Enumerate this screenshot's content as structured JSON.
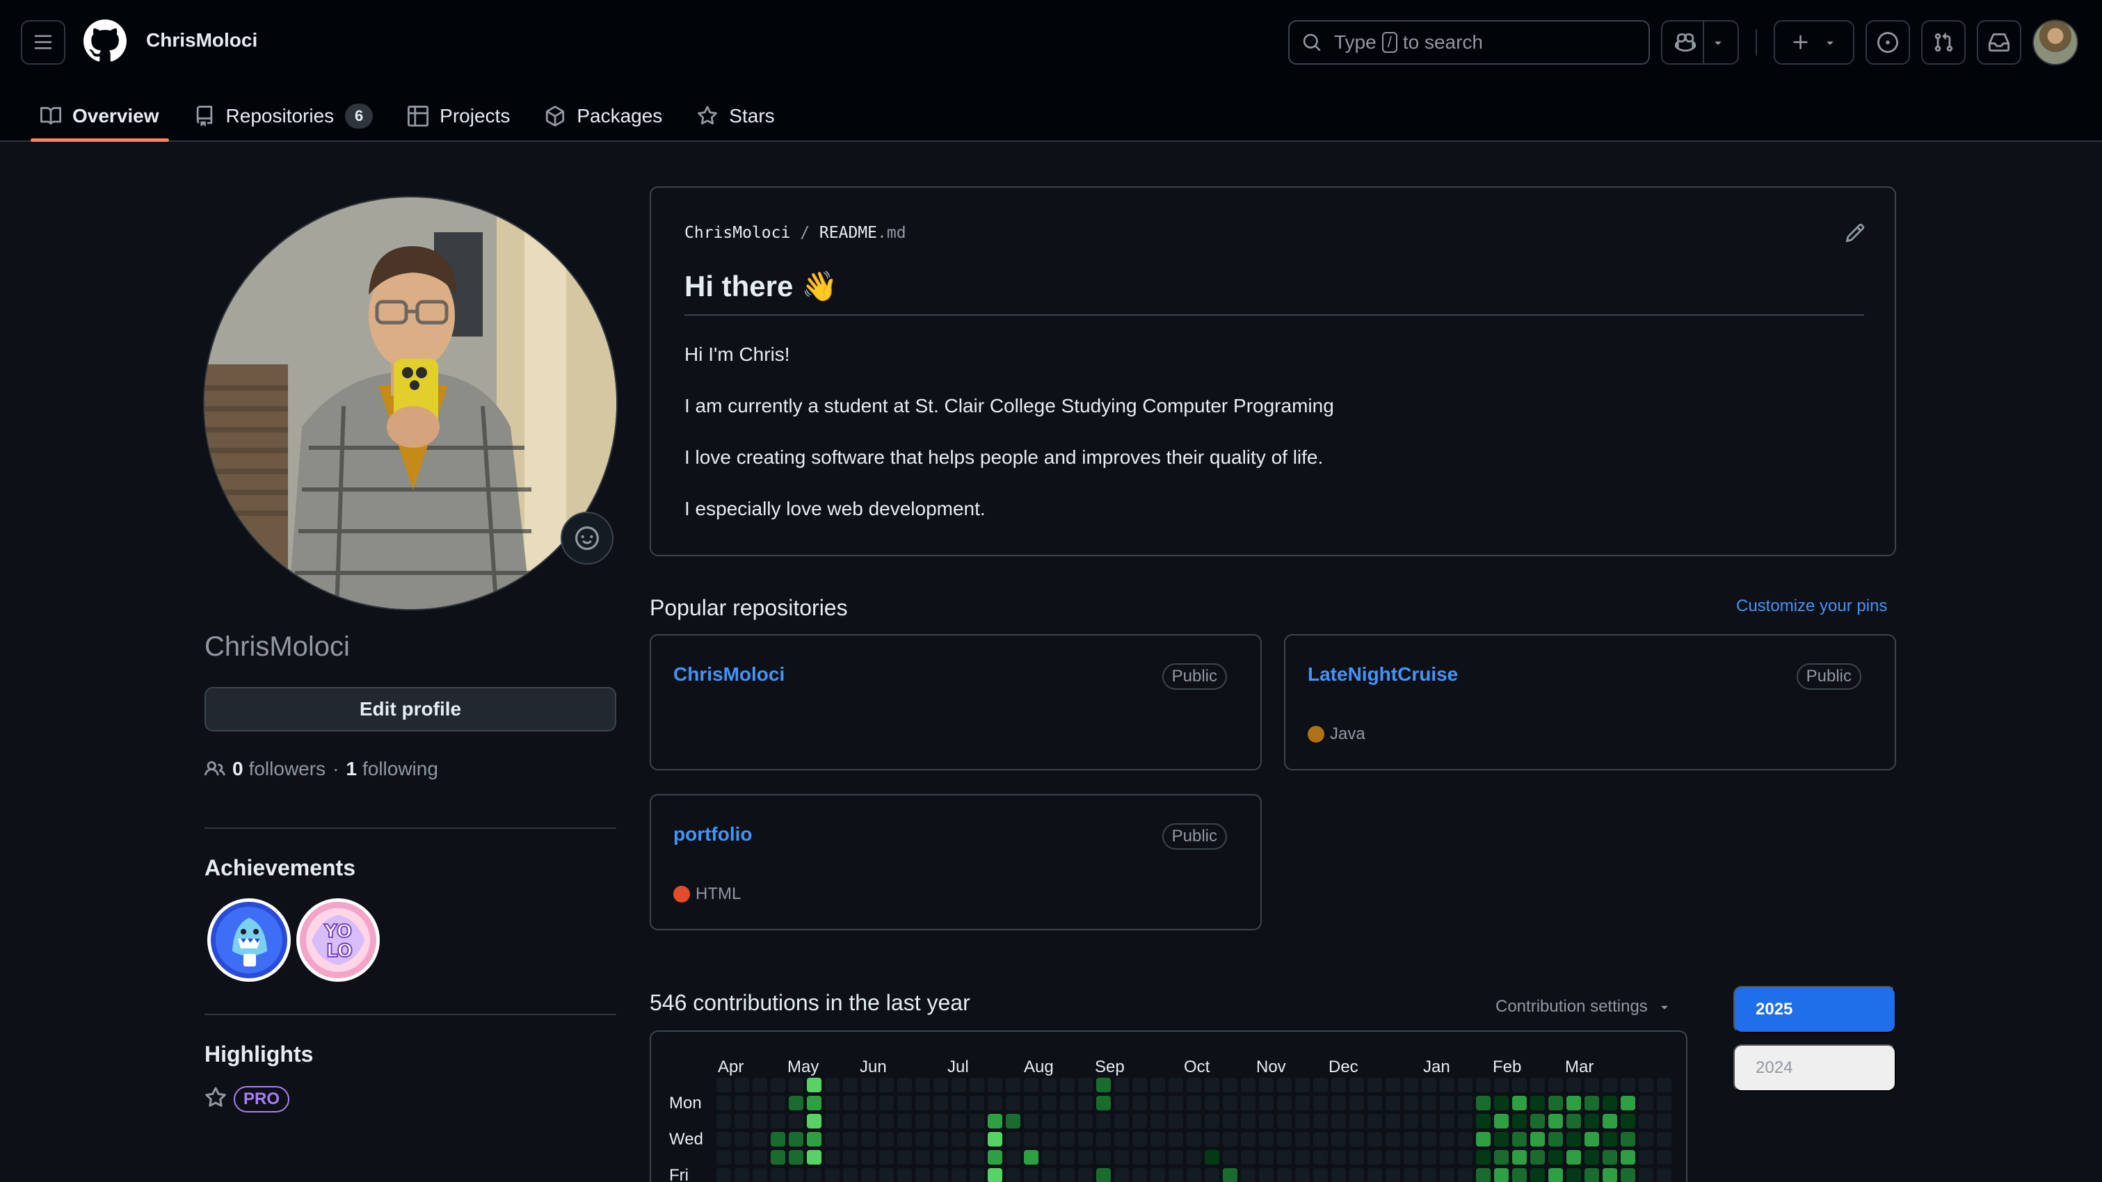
{
  "header": {
    "username": "ChrisMoloci",
    "search_prefix": "Type",
    "search_key": "/",
    "search_suffix": "to search"
  },
  "tabs": [
    {
      "label": "Overview",
      "active": true
    },
    {
      "label": "Repositories",
      "count": "6"
    },
    {
      "label": "Projects"
    },
    {
      "label": "Packages"
    },
    {
      "label": "Stars"
    }
  ],
  "sidebar": {
    "name": "ChrisMoloci",
    "edit_profile": "Edit profile",
    "followers_count": "0",
    "followers_label": "followers",
    "separator": "·",
    "following_count": "1",
    "following_label": "following",
    "achievements_title": "Achievements",
    "highlights_title": "Highlights",
    "pro_label": "PRO"
  },
  "readme": {
    "path_user": "ChrisMoloci",
    "path_sep": "/",
    "path_file": "README",
    "path_ext": ".md",
    "heading": "Hi there 👋",
    "paragraphs": [
      "Hi I'm Chris!",
      "I am currently a student at St. Clair College Studying Computer Programing",
      "I love creating software that helps people and improves their quality of life.",
      "I especially love web development."
    ]
  },
  "popular": {
    "title": "Popular repositories",
    "customize": "Customize your pins",
    "repos": [
      {
        "name": "ChrisMoloci",
        "visibility": "Public",
        "language": "",
        "lang_color": ""
      },
      {
        "name": "LateNightCruise",
        "visibility": "Public",
        "language": "Java",
        "lang_color": "#b07219"
      },
      {
        "name": "portfolio",
        "visibility": "Public",
        "language": "HTML",
        "lang_color": "#e34c26"
      }
    ]
  },
  "contributions": {
    "title": "546 contributions in the last year",
    "settings": "Contribution settings",
    "months": [
      "Apr",
      "May",
      "Jun",
      "Jul",
      "Aug",
      "Sep",
      "Oct",
      "Nov",
      "Dec",
      "Jan",
      "Feb",
      "Mar"
    ],
    "days": [
      "Mon",
      "Wed",
      "Fri"
    ],
    "years": [
      "2025",
      "2024"
    ],
    "colors": [
      "#151b23",
      "#033a16",
      "#196c2e",
      "#2ea043",
      "#56d364"
    ]
  }
}
